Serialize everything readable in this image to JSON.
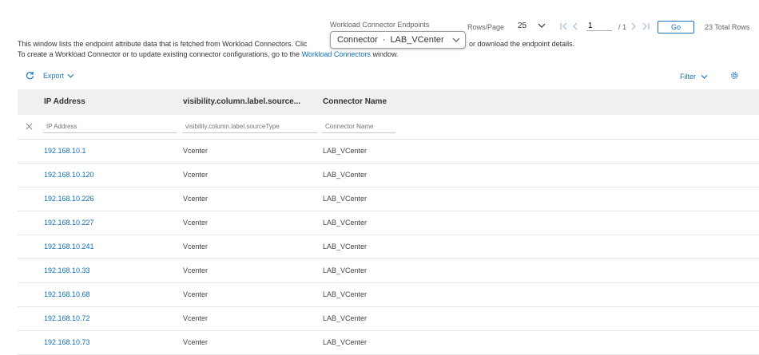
{
  "header": {
    "endpoints_label": "Workload Connector Endpoints",
    "connector_select": {
      "prefix": "Connector",
      "separator": "·",
      "value": "LAB_VCenter"
    },
    "rows_per_page_label": "Rows/Page",
    "rows_per_page_value": "25",
    "page_value": "1",
    "page_total": "/ 1",
    "go_label": "Go",
    "total_rows": "23 Total Rows"
  },
  "description": {
    "line1_start": "This window lists the endpoint attribute data that is fetched from Workload Connectors. Clic",
    "line1_end": "or download the endpoint details.",
    "line2_start": "To create a Workload Connector or to update existing connector configurations, go to the",
    "line2_link": "Workload Connectors",
    "line2_end": "window."
  },
  "toolbar": {
    "export_label": "Export",
    "filter_label": "Filter"
  },
  "table": {
    "columns": [
      "IP Address",
      "visibility.column.label.source...",
      "Connector Name"
    ],
    "filters": [
      "IP Address",
      "visibility.column.label.sourceType",
      "Connector Name"
    ],
    "rows": [
      {
        "ip": "192.168.10.1",
        "source": "Vcenter",
        "connector": "LAB_VCenter"
      },
      {
        "ip": "192.168.10.120",
        "source": "Vcenter",
        "connector": "LAB_VCenter"
      },
      {
        "ip": "192.168.10.226",
        "source": "Vcenter",
        "connector": "LAB_VCenter"
      },
      {
        "ip": "192.168.10.227",
        "source": "Vcenter",
        "connector": "LAB_VCenter"
      },
      {
        "ip": "192.168.10.241",
        "source": "Vcenter",
        "connector": "LAB_VCenter"
      },
      {
        "ip": "192.168.10.33",
        "source": "Vcenter",
        "connector": "LAB_VCenter"
      },
      {
        "ip": "192.168.10.68",
        "source": "Vcenter",
        "connector": "LAB_VCenter"
      },
      {
        "ip": "192.168.10.72",
        "source": "Vcenter",
        "connector": "LAB_VCenter"
      },
      {
        "ip": "192.168.10.73",
        "source": "Vcenter",
        "connector": "LAB_VCenter"
      }
    ]
  },
  "colors": {
    "link": "#0d6fb8",
    "accent": "#1e73be",
    "header_bg": "#eef0f2"
  }
}
